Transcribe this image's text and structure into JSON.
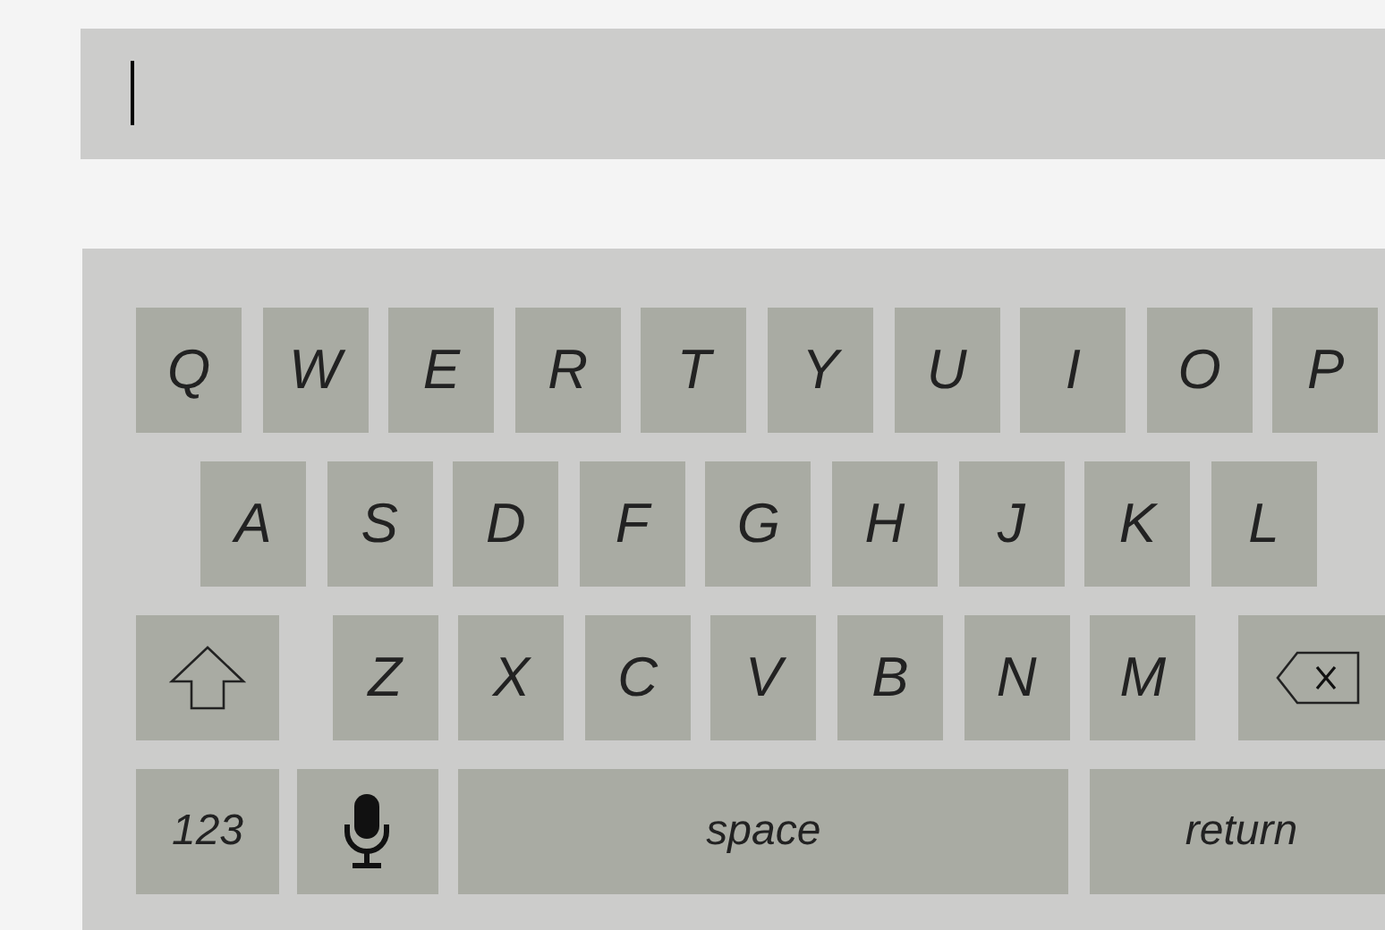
{
  "text_field": {
    "focused": true
  },
  "keyboard": {
    "rows": [
      {
        "keys": [
          {
            "kind": "letter",
            "label": "Q"
          },
          {
            "kind": "letter",
            "label": "W"
          },
          {
            "kind": "letter",
            "label": "E"
          },
          {
            "kind": "letter",
            "label": "R"
          },
          {
            "kind": "letter",
            "label": "T"
          },
          {
            "kind": "letter",
            "label": "Y"
          },
          {
            "kind": "letter",
            "label": "U"
          },
          {
            "kind": "letter",
            "label": "I"
          },
          {
            "kind": "letter",
            "label": "O"
          },
          {
            "kind": "letter",
            "label": "P"
          }
        ]
      },
      {
        "keys": [
          {
            "kind": "letter",
            "label": "A"
          },
          {
            "kind": "letter",
            "label": "S"
          },
          {
            "kind": "letter",
            "label": "D"
          },
          {
            "kind": "letter",
            "label": "F"
          },
          {
            "kind": "letter",
            "label": "G"
          },
          {
            "kind": "letter",
            "label": "H"
          },
          {
            "kind": "letter",
            "label": "J"
          },
          {
            "kind": "letter",
            "label": "K"
          },
          {
            "kind": "letter",
            "label": "L"
          }
        ]
      },
      {
        "keys": [
          {
            "kind": "shift"
          },
          {
            "kind": "letter",
            "label": "Z"
          },
          {
            "kind": "letter",
            "label": "X"
          },
          {
            "kind": "letter",
            "label": "C"
          },
          {
            "kind": "letter",
            "label": "V"
          },
          {
            "kind": "letter",
            "label": "B"
          },
          {
            "kind": "letter",
            "label": "N"
          },
          {
            "kind": "letter",
            "label": "M"
          },
          {
            "kind": "backspace"
          }
        ]
      },
      {
        "keys": [
          {
            "kind": "numbers",
            "label": "123"
          },
          {
            "kind": "mic"
          },
          {
            "kind": "space",
            "label": "space"
          },
          {
            "kind": "return",
            "label": "return"
          }
        ]
      }
    ]
  }
}
